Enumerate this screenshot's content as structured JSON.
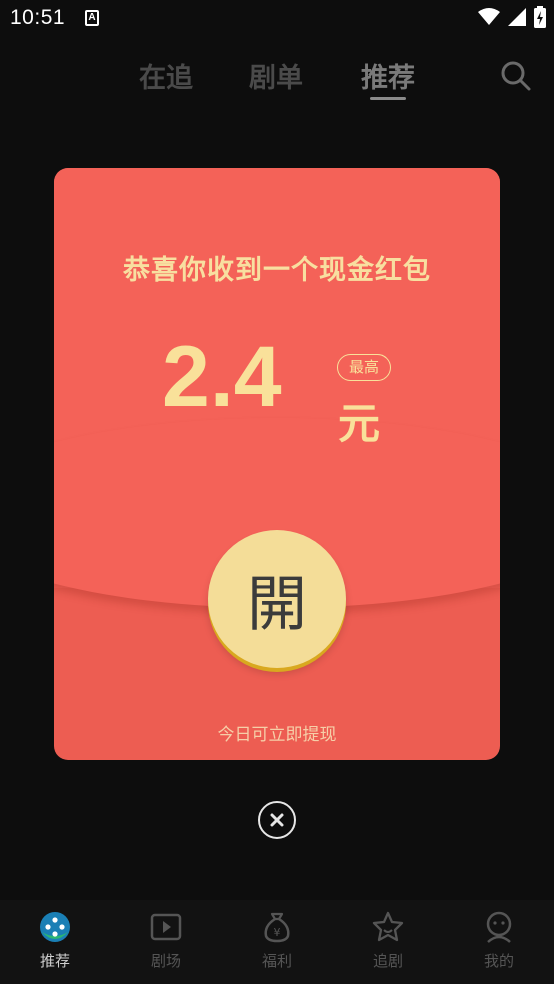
{
  "status_bar": {
    "time": "10:51",
    "notification_letter": "A"
  },
  "top_tabs": [
    {
      "label": "在追"
    },
    {
      "label": "剧单"
    },
    {
      "label": "推荐",
      "active": true
    }
  ],
  "red_packet": {
    "title": "恭喜你收到一个现金红包",
    "amount": "2.4",
    "badge": "最高",
    "unit": "元",
    "open_label": "開",
    "note": "今日可立即提现"
  },
  "bottom_nav": [
    {
      "label": "推荐",
      "icon": "recommend-icon",
      "active": true
    },
    {
      "label": "剧场",
      "icon": "theater-play-icon"
    },
    {
      "label": "福利",
      "icon": "money-bag-icon"
    },
    {
      "label": "追剧",
      "icon": "star-icon"
    },
    {
      "label": "我的",
      "icon": "profile-icon"
    }
  ],
  "colors": {
    "background": "#0d0d0d",
    "packet_red": "#f46258",
    "gold_text": "#f9e19a",
    "open_button": "#f4dd98"
  }
}
